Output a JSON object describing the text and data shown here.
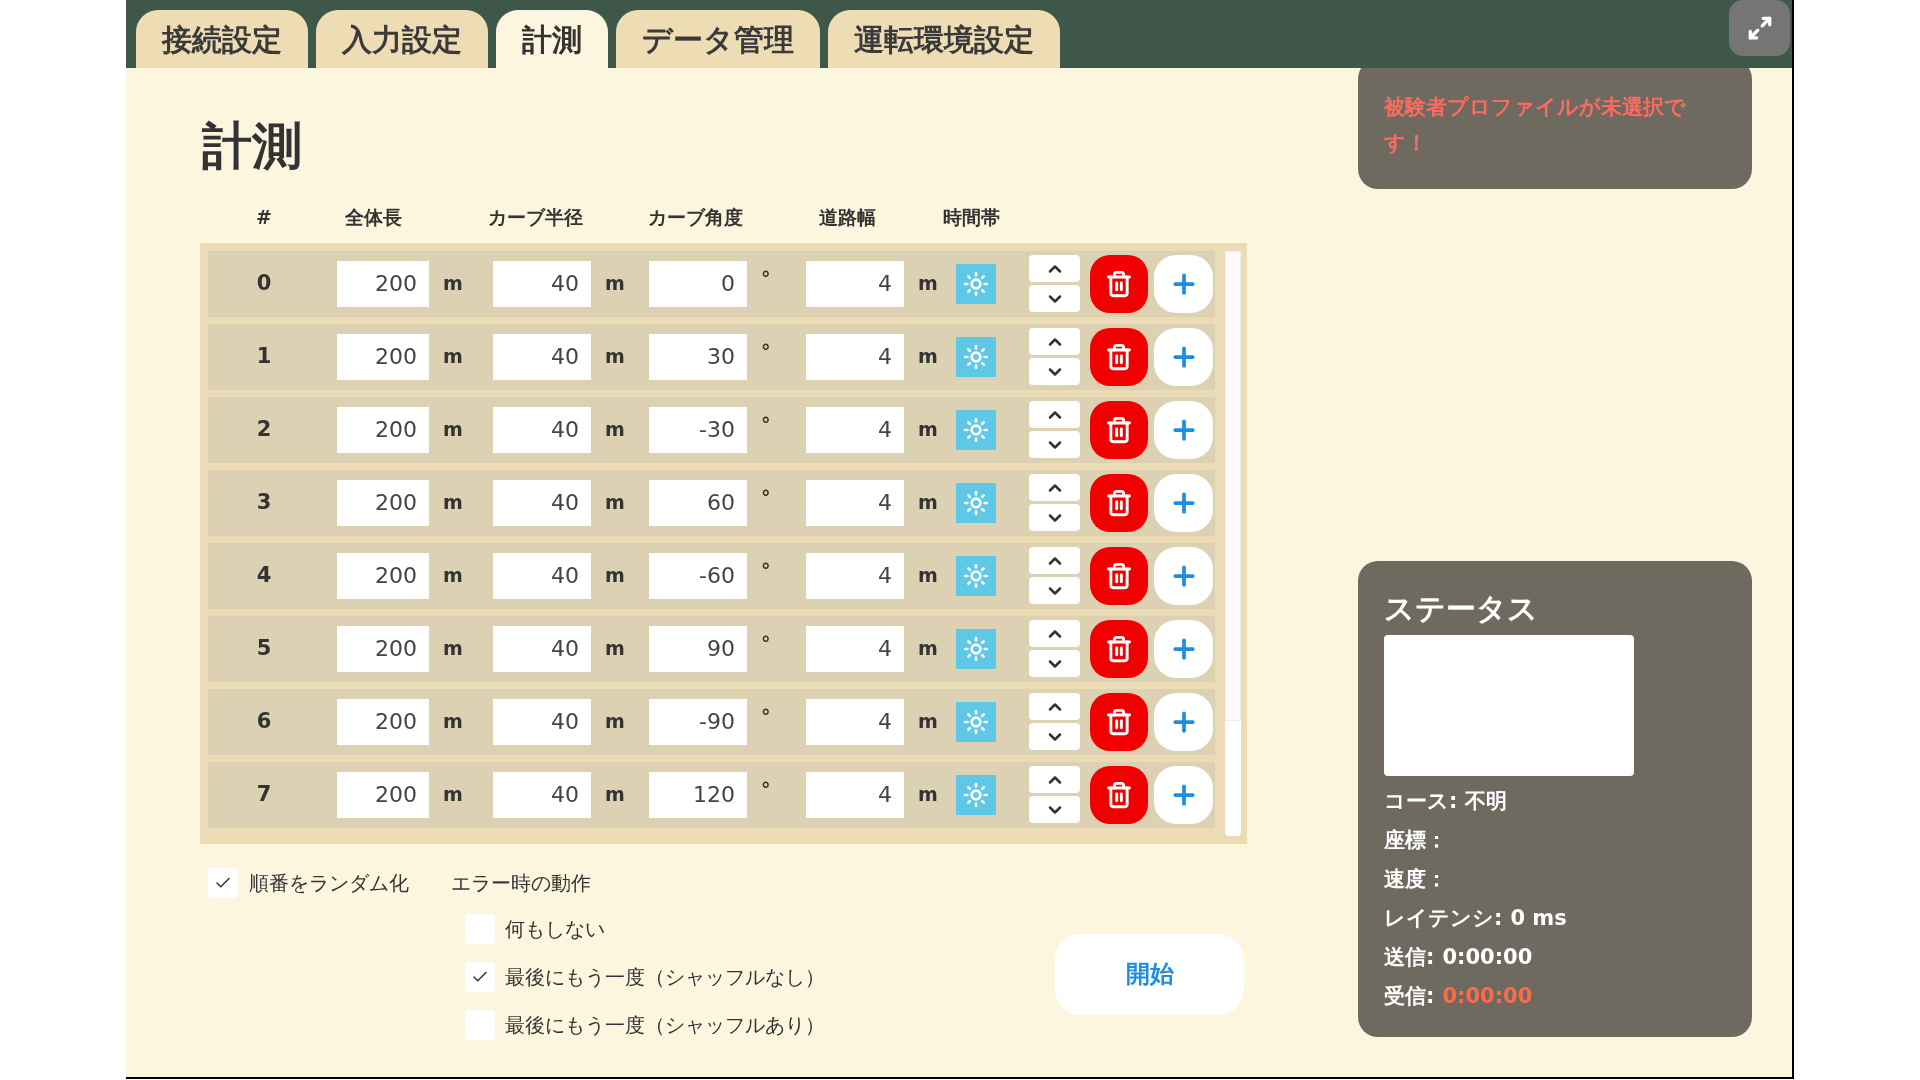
{
  "tabs": [
    {
      "label": "接続設定",
      "selected": false
    },
    {
      "label": "入力設定",
      "selected": false
    },
    {
      "label": "計測",
      "selected": true
    },
    {
      "label": "データ管理",
      "selected": false
    },
    {
      "label": "運転環境設定",
      "selected": false
    }
  ],
  "title": "計測",
  "columns": [
    "#",
    "全体長",
    "カーブ半径",
    "カーブ角度",
    "道路幅",
    "時間帯"
  ],
  "rows": [
    {
      "index": "0",
      "cells": [
        {
          "value": "200",
          "unit": "m"
        },
        {
          "value": "40",
          "unit": "m"
        },
        {
          "value": "0",
          "unit": "°"
        },
        {
          "value": "4",
          "unit": "m"
        }
      ]
    },
    {
      "index": "1",
      "cells": [
        {
          "value": "200",
          "unit": "m"
        },
        {
          "value": "40",
          "unit": "m"
        },
        {
          "value": "30",
          "unit": "°"
        },
        {
          "value": "4",
          "unit": "m"
        }
      ]
    },
    {
      "index": "2",
      "cells": [
        {
          "value": "200",
          "unit": "m"
        },
        {
          "value": "40",
          "unit": "m"
        },
        {
          "value": "-30",
          "unit": "°"
        },
        {
          "value": "4",
          "unit": "m"
        }
      ]
    },
    {
      "index": "3",
      "cells": [
        {
          "value": "200",
          "unit": "m"
        },
        {
          "value": "40",
          "unit": "m"
        },
        {
          "value": "60",
          "unit": "°"
        },
        {
          "value": "4",
          "unit": "m"
        }
      ]
    },
    {
      "index": "4",
      "cells": [
        {
          "value": "200",
          "unit": "m"
        },
        {
          "value": "40",
          "unit": "m"
        },
        {
          "value": "-60",
          "unit": "°"
        },
        {
          "value": "4",
          "unit": "m"
        }
      ]
    },
    {
      "index": "5",
      "cells": [
        {
          "value": "200",
          "unit": "m"
        },
        {
          "value": "40",
          "unit": "m"
        },
        {
          "value": "90",
          "unit": "°"
        },
        {
          "value": "4",
          "unit": "m"
        }
      ]
    },
    {
      "index": "6",
      "cells": [
        {
          "value": "200",
          "unit": "m"
        },
        {
          "value": "40",
          "unit": "m"
        },
        {
          "value": "-90",
          "unit": "°"
        },
        {
          "value": "4",
          "unit": "m"
        }
      ]
    },
    {
      "index": "7",
      "cells": [
        {
          "value": "200",
          "unit": "m"
        },
        {
          "value": "40",
          "unit": "m"
        },
        {
          "value": "120",
          "unit": "°"
        },
        {
          "value": "4",
          "unit": "m"
        }
      ]
    }
  ],
  "randomize": {
    "label": "順番をランダム化",
    "checked": true
  },
  "error_action": {
    "label": "エラー時の動作",
    "options": [
      {
        "label": "何もしない",
        "checked": false
      },
      {
        "label": "最後にもう一度（シャッフルなし）",
        "checked": true
      },
      {
        "label": "最後にもう一度（シャッフルあり）",
        "checked": false
      }
    ]
  },
  "start_button": "開始",
  "alert": "被験者プロファイルが未選択です！",
  "status": {
    "title": "ステータス",
    "lines": [
      {
        "label": "コース:",
        "value": "不明",
        "warning": false
      },
      {
        "label": "座標："
      },
      {
        "label": "速度："
      },
      {
        "label": "レイテンシ:",
        "value": "0 ms",
        "warning": false
      },
      {
        "label": "送信:",
        "value": "0:00:00",
        "warning": false
      },
      {
        "label": "受信:",
        "value": "0:00:00",
        "warning": true
      }
    ]
  }
}
